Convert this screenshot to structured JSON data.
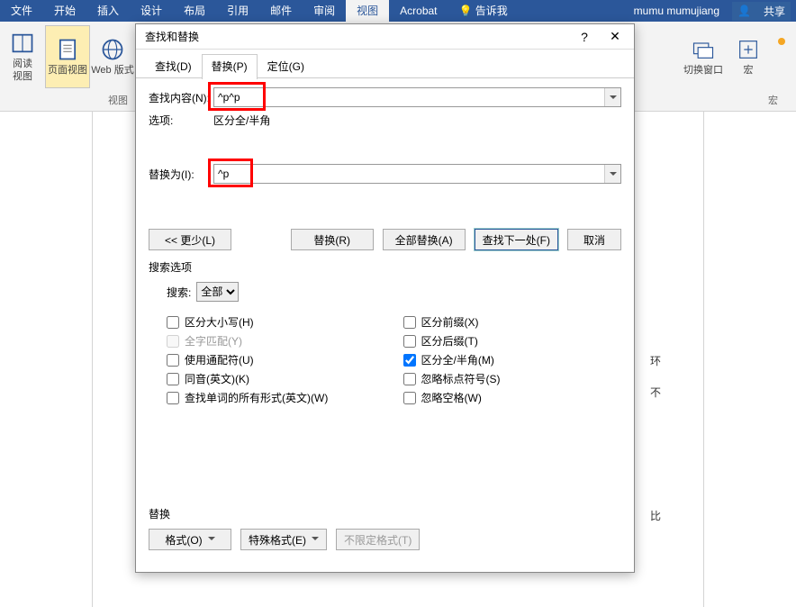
{
  "ribbon": {
    "tabs": [
      "文件",
      "开始",
      "插入",
      "设计",
      "布局",
      "引用",
      "邮件",
      "审阅",
      "视图",
      "Acrobat"
    ],
    "active_tab_index": 8,
    "tell_me": "告诉我",
    "user": "mumu mumujiang",
    "share": "共享",
    "view_btns": {
      "reading": "阅读\n视图",
      "page_layout": "页面视图",
      "web": "Web 版式"
    },
    "group_label_left": "视图",
    "right_btns": {
      "split": "切换窗口",
      "macros": "宏"
    },
    "group_label_right": "宏"
  },
  "side_fragments": [
    "环",
    "不",
    "比"
  ],
  "dialog": {
    "title": "查找和替换",
    "tabs": {
      "find": "查找(D)",
      "replace": "替换(P)",
      "goto": "定位(G)"
    },
    "active_tab": "replace",
    "find_label": "查找内容(N):",
    "find_value": "^p^p",
    "options_label": "选项:",
    "options_value": "区分全/半角",
    "replace_label": "替换为(I):",
    "replace_value": "^p",
    "buttons": {
      "less": "<< 更少(L)",
      "replace": "替换(R)",
      "replace_all": "全部替换(A)",
      "find_next": "查找下一处(F)",
      "cancel": "取消"
    },
    "search_section": "搜索选项",
    "search_label": "搜索:",
    "search_value": "全部",
    "checkboxes_left": [
      {
        "label": "区分大小写(H)",
        "checked": false,
        "disabled": false
      },
      {
        "label": "全字匹配(Y)",
        "checked": false,
        "disabled": true
      },
      {
        "label": "使用通配符(U)",
        "checked": false,
        "disabled": false
      },
      {
        "label": "同音(英文)(K)",
        "checked": false,
        "disabled": false
      },
      {
        "label": "查找单词的所有形式(英文)(W)",
        "checked": false,
        "disabled": false
      }
    ],
    "checkboxes_right": [
      {
        "label": "区分前缀(X)",
        "checked": false,
        "disabled": false
      },
      {
        "label": "区分后缀(T)",
        "checked": false,
        "disabled": false
      },
      {
        "label": "区分全/半角(M)",
        "checked": true,
        "disabled": false
      },
      {
        "label": "忽略标点符号(S)",
        "checked": false,
        "disabled": false
      },
      {
        "label": "忽略空格(W)",
        "checked": false,
        "disabled": false
      }
    ],
    "replace_section": "替换",
    "bottom_buttons": {
      "format": "格式(O)",
      "special": "特殊格式(E)",
      "noformat": "不限定格式(T)"
    }
  }
}
